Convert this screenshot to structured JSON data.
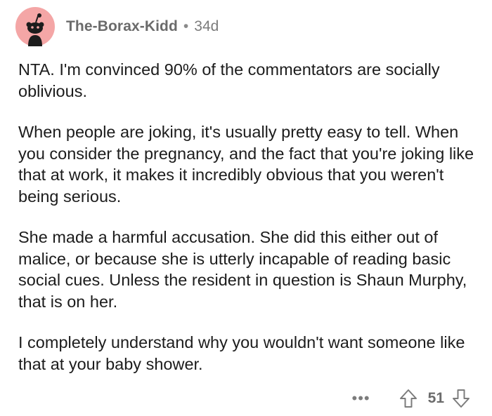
{
  "comment": {
    "author": "The-Borax-Kidd",
    "separator": "•",
    "age": "34d",
    "avatar_icon": "snoo-avatar-icon",
    "avatar_color": "#f4a6a6",
    "paragraphs": [
      "NTA. I'm convinced 90% of the commentators are socially oblivious.",
      "When people are joking, it's usually pretty easy to tell. When you consider the pregnancy, and the fact that you're joking like that at work, it makes it incredibly obvious that you weren't being serious.",
      "She made a harmful accusation. She did this either out of malice, or because she is utterly incapable of reading basic social cues. Unless the resident in question is Shaun Murphy, that is on her.",
      "I completely understand why you wouldn't want someone like that at your baby shower."
    ],
    "actions": {
      "more_label": "•••",
      "upvote_icon": "upvote-arrow-icon",
      "score": "51",
      "downvote_icon": "downvote-arrow-icon"
    }
  }
}
